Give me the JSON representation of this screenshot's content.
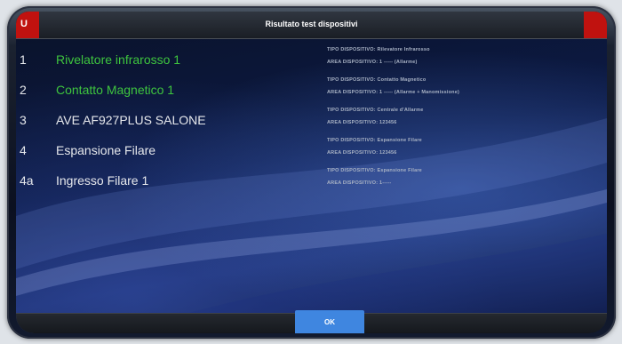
{
  "header": {
    "title": "Risultato test dispositivi",
    "left_corner_mark": "U"
  },
  "devices": [
    {
      "num": "1",
      "name": "Rivelatore infrarosso 1",
      "status": "ok",
      "type_line": "TIPO DISPOSITIVO: Rilevatore Infrarosso",
      "area_line": "AREA DISPOSITIVO: 1 ----- (Allarme)"
    },
    {
      "num": "2",
      "name": "Contatto Magnetico 1",
      "status": "ok",
      "type_line": "TIPO DISPOSITIVO: Contatto Magnetico",
      "area_line": "AREA DISPOSITIVO: 1 ----- (Allarme + Manomissione)"
    },
    {
      "num": "3",
      "name": "AVE AF927PLUS SALONE",
      "status": "normal",
      "type_line": "TIPO DISPOSITIVO: Centrale d'Allarme",
      "area_line": "AREA DISPOSITIVO: 123456"
    },
    {
      "num": "4",
      "name": "Espansione Filare",
      "status": "normal",
      "type_line": "TIPO DISPOSITIVO: Espansione Filare",
      "area_line": "AREA DISPOSITIVO: 123456"
    },
    {
      "num": "4a",
      "name": "Ingresso Filare 1",
      "status": "normal",
      "type_line": "TIPO DISPOSITIVO: Espansione Filare",
      "area_line": "AREA DISPOSITIVO: 1-----"
    }
  ],
  "footer": {
    "ok_label": "OK"
  },
  "colors": {
    "ok_text": "#3ec43e",
    "normal_text": "#e6e8ec",
    "accent_red": "#c0120f",
    "button_blue": "#3f86e0"
  }
}
